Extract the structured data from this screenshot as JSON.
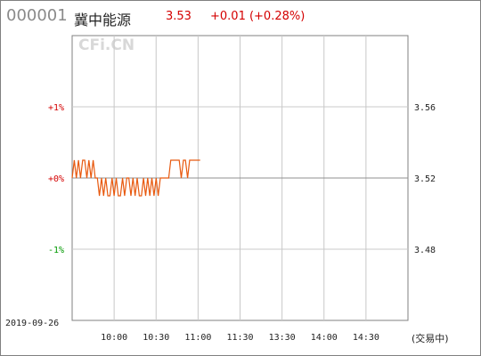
{
  "header": {
    "code": "000001",
    "name": "冀中能源",
    "price": "3.53",
    "change": "+0.01 (+0.28%)"
  },
  "watermark": "CFi.CN",
  "date_label": "2019-09-26",
  "status_label": "(交易中)",
  "colors": {
    "line": "#e85a10",
    "up": "#d40000",
    "down": "#009900",
    "grid": "#c8c8c8",
    "axis": "#808080"
  },
  "chart_data": {
    "type": "line",
    "title": "",
    "prev_close": 3.52,
    "ylim": [
      3.44,
      3.6
    ],
    "y_ticks_right": [
      "3.56",
      "3.52",
      "3.48"
    ],
    "y_ticks_right_values": [
      3.56,
      3.52,
      3.48
    ],
    "y_ticks_left": [
      "+1%",
      "+0%",
      "-1%"
    ],
    "y_ticks_left_values": [
      3.56,
      3.52,
      3.48
    ],
    "x_ticks": [
      "10:00",
      "10:30",
      "11:00",
      "11:30",
      "13:30",
      "14:00",
      "14:30"
    ],
    "x_tick_minutes": [
      30,
      60,
      90,
      120,
      150,
      180,
      210
    ],
    "x_range_minutes": [
      0,
      240
    ],
    "series": [
      {
        "values": [
          3.52,
          3.53,
          3.52,
          3.53,
          3.52,
          3.53,
          3.53,
          3.52,
          3.53,
          3.52,
          3.53,
          3.52,
          3.52,
          3.51,
          3.52,
          3.51,
          3.52,
          3.51,
          3.51,
          3.52,
          3.51,
          3.52,
          3.51,
          3.51,
          3.52,
          3.51,
          3.52,
          3.52,
          3.51,
          3.52,
          3.51,
          3.52,
          3.51,
          3.51,
          3.52,
          3.51,
          3.52,
          3.51,
          3.52,
          3.51,
          3.52,
          3.51,
          3.52,
          3.52,
          3.52,
          3.52,
          3.52,
          3.53,
          3.53,
          3.53,
          3.53,
          3.53,
          3.52,
          3.53,
          3.53,
          3.52,
          3.53,
          3.53,
          3.53,
          3.53,
          3.53,
          3.53
        ]
      }
    ]
  }
}
